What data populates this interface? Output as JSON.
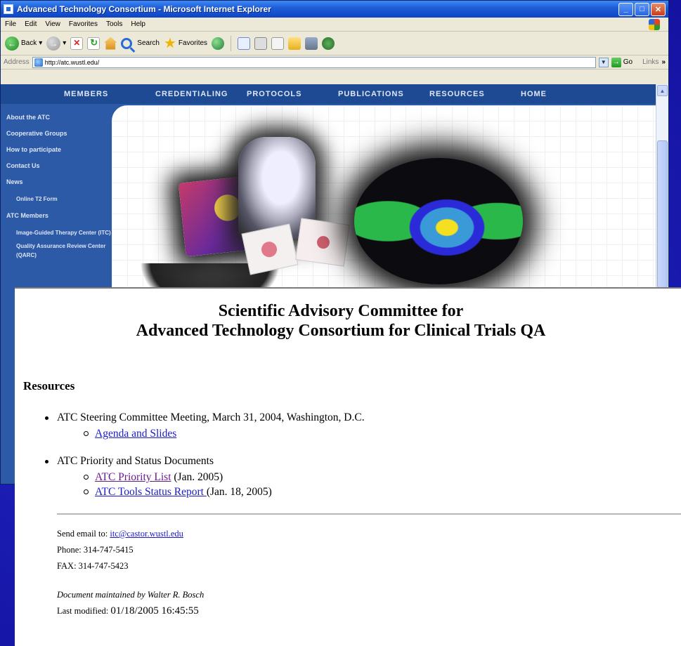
{
  "browser": {
    "title": "Advanced Technology Consortium - Microsoft Internet Explorer",
    "menu": [
      "File",
      "Edit",
      "View",
      "Favorites",
      "Tools",
      "Help"
    ],
    "toolbar": {
      "back": "Back",
      "search": "Search",
      "favorites": "Favorites"
    },
    "address_label": "Address",
    "address_value": "http://atc.wustl.edu/",
    "go_label": "Go",
    "links_label": "Links",
    "links_chevron": "»"
  },
  "site": {
    "nav": [
      "MEMBERS",
      "CREDENTIALING",
      "PROTOCOLS",
      "PUBLICATIONS",
      "RESOURCES",
      "HOME"
    ],
    "side": {
      "about": "About the ATC",
      "groups": "Cooperative Groups",
      "participate": "How to participate",
      "contact": "Contact Us",
      "news": "News",
      "online_form": "Online T2 Form",
      "members": "ATC Members",
      "igtc": "Image-Guided Therapy Center (ITC)",
      "qarc": "Quality Assurance Review Center (QARC)"
    }
  },
  "doc": {
    "title_line1": "Scientific Advisory Committee for",
    "title_line2": "Advanced Technology Consortium for Clinical Trials QA",
    "section": "Resources",
    "item1": "ATC Steering Committee Meeting, March 31, 2004, Washington, D.C.",
    "item1_link": "Agenda and Slides",
    "item2": "ATC Priority and Status Documents",
    "item2_link1": "ATC Priority List",
    "item2_link1_note": "(Jan. 2005)",
    "item2_link2": "ATC Tools Status Report ",
    "item2_link2_note": "(Jan. 18, 2005)",
    "email_label": "Send email to: ",
    "email": "itc@castor.wustl.edu",
    "phone": "Phone: 314-747-5415",
    "fax": "FAX: 314-747-5423",
    "maintained": "Document maintained by Walter R. Bosch",
    "modified_label": "Last modified: ",
    "modified_value": "01/18/2005 16:45:55"
  }
}
